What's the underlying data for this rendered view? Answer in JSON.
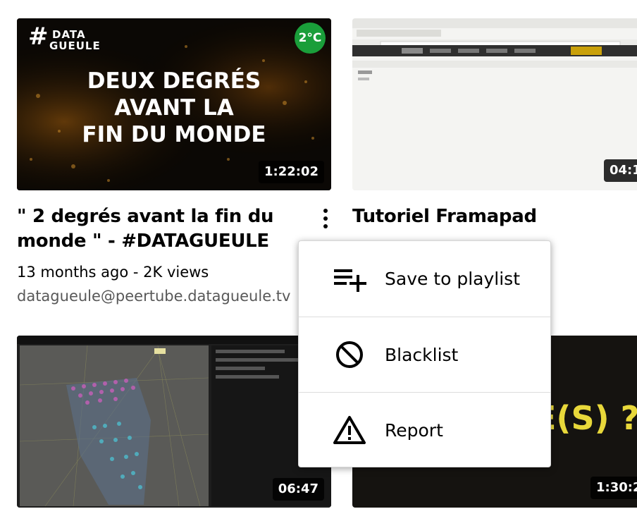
{
  "videos": [
    {
      "title": "\" 2 degrés avant la fin du monde \" - #DATAGUEULE",
      "duration": "1:22:02",
      "meta": "13 months ago - 2K views",
      "account": "datagueule@peertube.datagueule.tv",
      "thumb_text": {
        "brand_hash": "#",
        "brand_top": "DATA",
        "brand_bottom": "GUEULE",
        "badge": "2°C",
        "headline_1": "DEUX DEGRÉS",
        "headline_2": "AVANT LA",
        "headline_3": "FIN DU MONDE"
      }
    },
    {
      "title": "Tutoriel Framapad",
      "duration": "04:1"
    },
    {
      "duration": "06:47"
    },
    {
      "duration": "1:30:2",
      "thumb_text": "E(S) ?"
    }
  ],
  "menu": {
    "items": [
      {
        "label": "Save to playlist",
        "icon": "playlist-add-icon"
      },
      {
        "label": "Blacklist",
        "icon": "blacklist-icon"
      },
      {
        "label": "Report",
        "icon": "warning-icon"
      }
    ]
  },
  "colors": {
    "badge_green": "#1a9e3a",
    "thumb4_yellow": "#e8d83a"
  }
}
